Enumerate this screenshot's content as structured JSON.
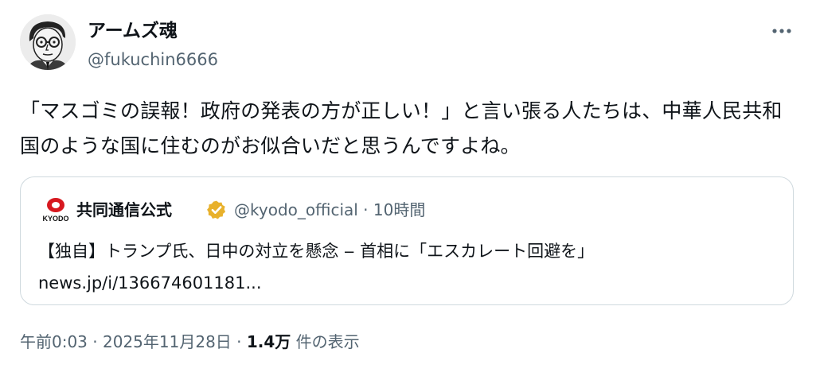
{
  "author": {
    "display_name": "アームズ魂",
    "handle": "@fukuchin6666"
  },
  "post": {
    "text": "「マスゴミの誤報！政府の発表の方が正しい！」と言い張る人たちは、中華人民共和国のような国に住むのがお似合いだと思うんですよね。"
  },
  "quote": {
    "logo_text": "KYODO",
    "name": "共同通信公式",
    "handle": "@kyodo_official",
    "separator": "·",
    "time": "10時間",
    "text": "【独自】トランプ氏、日中の対立を懸念 ‒ 首相に「エスカレート回避を」",
    "link": "news.jp/i/136674601181..."
  },
  "footer": {
    "time": "午前0:03",
    "date": "2025年11月28日",
    "views_count": "1.4万",
    "views_label": "件の表示",
    "separator": "·"
  },
  "colors": {
    "text": "#0f1419",
    "secondary": "#536471",
    "border": "#cfd9de",
    "kyodo_red": "#d71920",
    "verified_gold": "#e8b12c"
  }
}
